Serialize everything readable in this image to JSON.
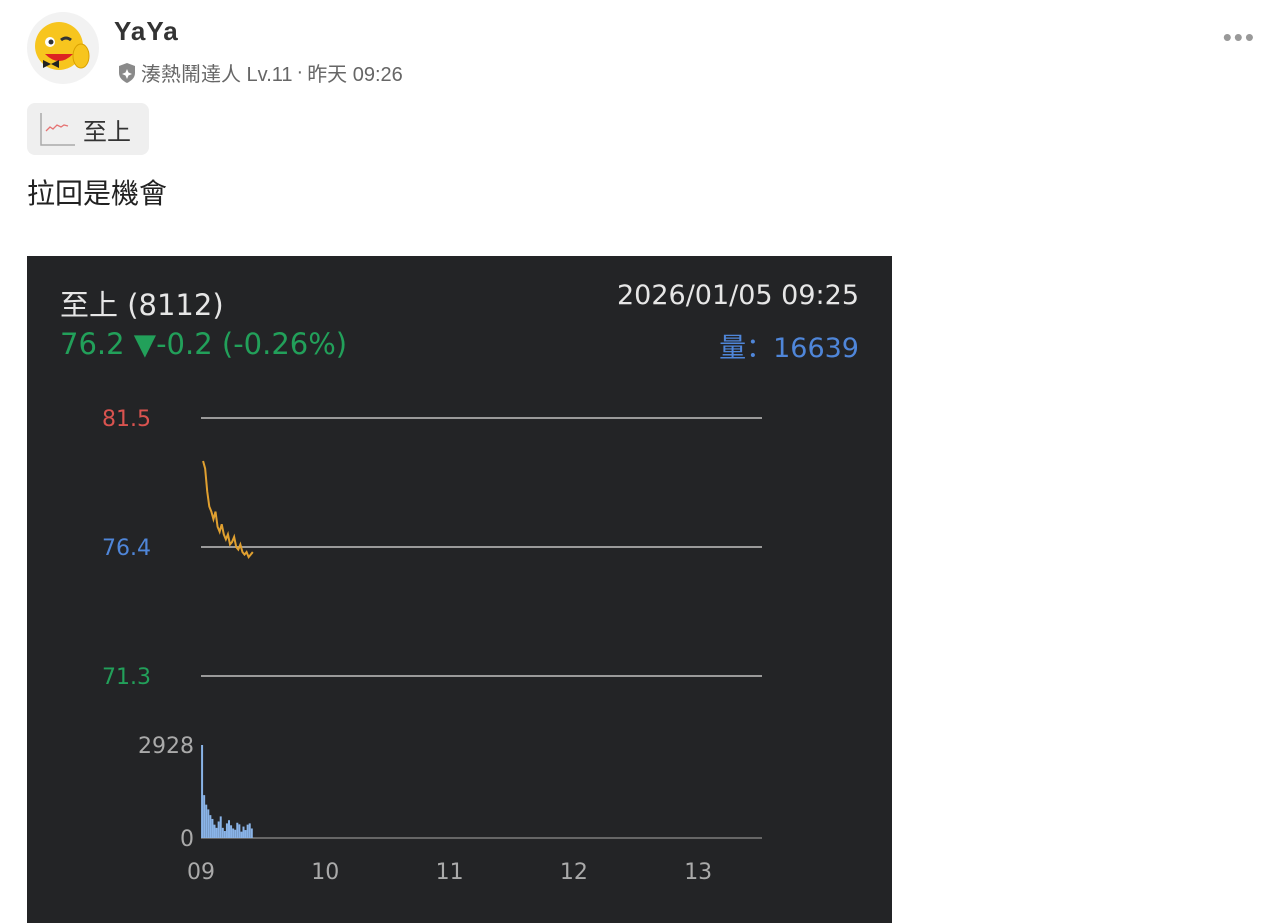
{
  "post": {
    "author": "YaYa",
    "badge": "湊熱鬧達人 Lv.11",
    "separator": "·",
    "time": "昨天 09:26",
    "tag": "至上",
    "text": "拉回是機會",
    "more": "•••"
  },
  "chart_data": {
    "type": "line",
    "title": "至上 (8112)",
    "datetime": "2026/01/05 09:25",
    "quote": "76.2 ▼-0.2 (-0.26%)",
    "volume_label": "量：16639",
    "price_ticks": [
      {
        "label": "81.5",
        "value": 81.5,
        "color": "#d9534f"
      },
      {
        "label": "76.4",
        "value": 76.4,
        "color": "#4f86d9"
      },
      {
        "label": "71.3",
        "value": 71.3,
        "color": "#22a05a"
      }
    ],
    "volume_ticks": [
      {
        "label": "2928",
        "value": 2928
      },
      {
        "label": "0",
        "value": 0
      }
    ],
    "x_ticks": [
      "09",
      "10",
      "11",
      "12",
      "13"
    ],
    "minutes_from_0900": [
      1,
      2,
      3,
      4,
      5,
      6,
      7,
      8,
      9,
      10,
      11,
      12,
      13,
      14,
      15,
      16,
      17,
      18,
      19,
      20,
      21,
      22,
      23,
      24,
      25
    ],
    "price": [
      79.8,
      79.5,
      78.6,
      78.0,
      77.8,
      77.5,
      77.8,
      77.2,
      77.0,
      77.3,
      76.9,
      76.7,
      76.9,
      76.5,
      76.6,
      76.8,
      76.4,
      76.3,
      76.5,
      76.2,
      76.1,
      76.2,
      76.0,
      76.1,
      76.2
    ],
    "volume": [
      2928,
      1350,
      1050,
      900,
      720,
      600,
      420,
      320,
      520,
      680,
      320,
      220,
      460,
      560,
      400,
      300,
      260,
      480,
      430,
      200,
      360,
      250,
      420,
      460,
      300
    ],
    "colors": {
      "line": "#e0a030",
      "volume": "#8ab4e8",
      "grid": "#9a9a9a"
    }
  }
}
